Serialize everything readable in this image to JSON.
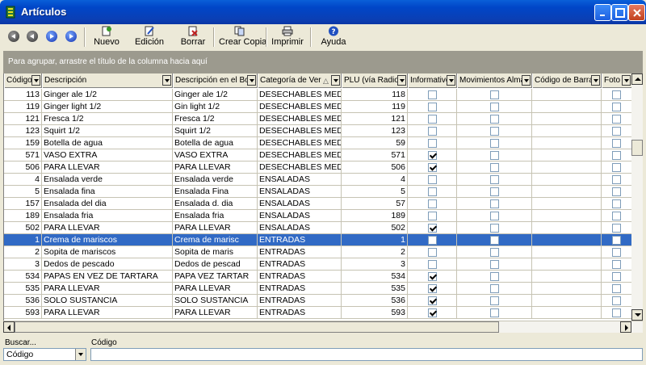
{
  "window": {
    "title": "Artículos"
  },
  "toolbar": {
    "nuevo": "Nuevo",
    "edicion": "Edición",
    "borrar": "Borrar",
    "crear_copia": "Crear Copia",
    "imprimir": "Imprimir",
    "ayuda": "Ayuda"
  },
  "group_panel": {
    "text": "Para agrupar, arrastre el título de la columna hacia aquí"
  },
  "columns": [
    {
      "label": "Código"
    },
    {
      "label": "Descripción"
    },
    {
      "label": "Descripción en el Boti"
    },
    {
      "label": "Categoría de Ver"
    },
    {
      "label": "PLU (vía Radio"
    },
    {
      "label": "Informativo"
    },
    {
      "label": "Movimientos Almac"
    },
    {
      "label": "Código de Barras"
    },
    {
      "label": "Foto"
    }
  ],
  "rows": [
    {
      "codigo": "113",
      "descripcion": "Ginger ale 1/2",
      "boton": "Ginger ale 1/2",
      "categoria": "DESECHABLES MED O",
      "plu": "118",
      "informativo": false,
      "movimientos": false,
      "foto": false,
      "selected": false
    },
    {
      "codigo": "119",
      "descripcion": "Ginger light 1/2",
      "boton": "Gin light 1/2",
      "categoria": "DESECHABLES MED O",
      "plu": "119",
      "informativo": false,
      "movimientos": false,
      "foto": false,
      "selected": false
    },
    {
      "codigo": "121",
      "descripcion": "Fresca 1/2",
      "boton": "Fresca 1/2",
      "categoria": "DESECHABLES MED O",
      "plu": "121",
      "informativo": false,
      "movimientos": false,
      "foto": false,
      "selected": false
    },
    {
      "codigo": "123",
      "descripcion": "Squirt 1/2",
      "boton": "Squirt 1/2",
      "categoria": "DESECHABLES MED O",
      "plu": "123",
      "informativo": false,
      "movimientos": false,
      "foto": false,
      "selected": false
    },
    {
      "codigo": "159",
      "descripcion": "Botella de agua",
      "boton": "Botella de agua",
      "categoria": "DESECHABLES MED O",
      "plu": "59",
      "informativo": false,
      "movimientos": false,
      "foto": false,
      "selected": false
    },
    {
      "codigo": "571",
      "descripcion": "VASO EXTRA",
      "boton": "VASO EXTRA",
      "categoria": "DESECHABLES MED O",
      "plu": "571",
      "informativo": true,
      "movimientos": false,
      "foto": false,
      "selected": false
    },
    {
      "codigo": "506",
      "descripcion": "PARA LLEVAR",
      "boton": "PARA LLEVAR",
      "categoria": "DESECHABLES MED O",
      "plu": "506",
      "informativo": true,
      "movimientos": false,
      "foto": false,
      "selected": false
    },
    {
      "codigo": "4",
      "descripcion": "Ensalada verde",
      "boton": "Ensalada verde",
      "categoria": "ENSALADAS",
      "plu": "4",
      "informativo": false,
      "movimientos": false,
      "foto": false,
      "selected": false
    },
    {
      "codigo": "5",
      "descripcion": "Ensalada fina",
      "boton": "Ensalada Fina",
      "categoria": "ENSALADAS",
      "plu": "5",
      "informativo": false,
      "movimientos": false,
      "foto": false,
      "selected": false
    },
    {
      "codigo": "157",
      "descripcion": "Ensalada del dia",
      "boton": "Ensalada d. dia",
      "categoria": "ENSALADAS",
      "plu": "57",
      "informativo": false,
      "movimientos": false,
      "foto": false,
      "selected": false
    },
    {
      "codigo": "189",
      "descripcion": "Ensalada fria",
      "boton": "Ensalada fria",
      "categoria": "ENSALADAS",
      "plu": "189",
      "informativo": false,
      "movimientos": false,
      "foto": false,
      "selected": false
    },
    {
      "codigo": "502",
      "descripcion": "PARA LLEVAR",
      "boton": "PARA LLEVAR",
      "categoria": "ENSALADAS",
      "plu": "502",
      "informativo": true,
      "movimientos": false,
      "foto": false,
      "selected": false
    },
    {
      "codigo": "1",
      "descripcion": "Crema de mariscos",
      "boton": "Crema de marisc",
      "categoria": "ENTRADAS",
      "plu": "1",
      "informativo": false,
      "movimientos": false,
      "foto": false,
      "selected": true
    },
    {
      "codigo": "2",
      "descripcion": "Sopita de mariscos",
      "boton": "Sopita de maris",
      "categoria": "ENTRADAS",
      "plu": "2",
      "informativo": false,
      "movimientos": false,
      "foto": false,
      "selected": false
    },
    {
      "codigo": "3",
      "descripcion": "Dedos de pescado",
      "boton": "Dedos de pescad",
      "categoria": "ENTRADAS",
      "plu": "3",
      "informativo": false,
      "movimientos": false,
      "foto": false,
      "selected": false
    },
    {
      "codigo": "534",
      "descripcion": "PAPAS EN VEZ DE TARTARA",
      "boton": "PAPA VEZ TARTAR",
      "categoria": "ENTRADAS",
      "plu": "534",
      "informativo": true,
      "movimientos": false,
      "foto": false,
      "selected": false
    },
    {
      "codigo": "535",
      "descripcion": "PARA LLEVAR",
      "boton": "PARA LLEVAR",
      "categoria": "ENTRADAS",
      "plu": "535",
      "informativo": true,
      "movimientos": false,
      "foto": false,
      "selected": false
    },
    {
      "codigo": "536",
      "descripcion": "SOLO SUSTANCIA",
      "boton": "SOLO SUSTANCIA",
      "categoria": "ENTRADAS",
      "plu": "536",
      "informativo": true,
      "movimientos": false,
      "foto": false,
      "selected": false
    },
    {
      "codigo": "593",
      "descripcion": "PARA LLEVAR",
      "boton": "PARA LLEVAR",
      "categoria": "ENTRADAS",
      "plu": "593",
      "informativo": true,
      "movimientos": false,
      "foto": false,
      "selected": false
    }
  ],
  "search": {
    "buscar_label": "Buscar...",
    "field_label": "Código",
    "selected_field": "Código",
    "value": ""
  },
  "colors": {
    "selection": "#316ac5",
    "titlebar": "#0046c8",
    "group_panel": "#9c9a8e"
  },
  "icons": {
    "first": "first-record-icon",
    "prev": "prev-record-icon",
    "next": "next-record-icon",
    "last": "last-record-icon",
    "nuevo": "new-document-icon",
    "edicion": "edit-icon",
    "borrar": "delete-icon",
    "crear_copia": "copy-icon",
    "imprimir": "printer-icon",
    "ayuda": "help-icon"
  }
}
